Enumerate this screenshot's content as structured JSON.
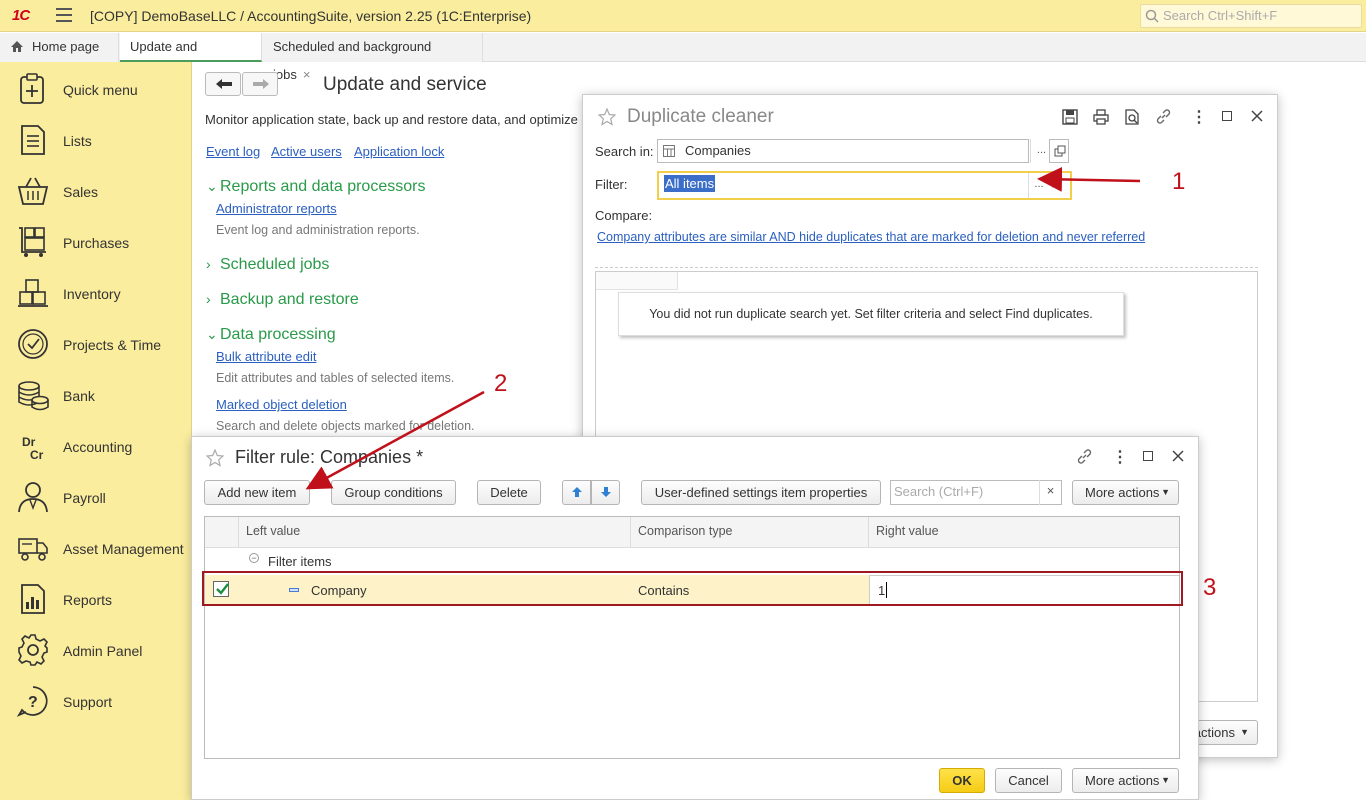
{
  "app": {
    "logo": "1C",
    "title": "[COPY] DemoBaseLLC / AccountingSuite, version 2.25  (1C:Enterprise)",
    "search_placeholder": "Search Ctrl+Shift+F"
  },
  "tabs": [
    {
      "label": "Home page"
    },
    {
      "label": "Update and service",
      "close": "×"
    },
    {
      "label": "Scheduled and background jobs",
      "close": "×"
    }
  ],
  "sidebar": {
    "items": [
      {
        "label": "Quick menu",
        "icon": "quick-menu-icon"
      },
      {
        "label": "Lists",
        "icon": "lists-icon"
      },
      {
        "label": "Sales",
        "icon": "basket-icon"
      },
      {
        "label": "Purchases",
        "icon": "cart-icon"
      },
      {
        "label": "Inventory",
        "icon": "boxes-icon"
      },
      {
        "label": "Projects & Time",
        "icon": "clock-icon"
      },
      {
        "label": "Bank",
        "icon": "coins-icon"
      },
      {
        "label": "Accounting",
        "icon": "dr-cr-icon"
      },
      {
        "label": "Payroll",
        "icon": "person-icon"
      },
      {
        "label": "Asset Management",
        "icon": "truck-icon"
      },
      {
        "label": "Reports",
        "icon": "report-icon"
      },
      {
        "label": "Admin Panel",
        "icon": "gear-icon"
      },
      {
        "label": "Support",
        "icon": "question-icon"
      }
    ]
  },
  "main": {
    "title": "Update and service",
    "description": "Monitor application state, back up and restore data, and optimize",
    "links": [
      "Event log",
      "Active users",
      "Application lock"
    ],
    "sections": {
      "reports": {
        "title": "Reports and data processors",
        "link": "Administrator reports",
        "desc": "Event log and administration reports."
      },
      "scheduled": {
        "title": "Scheduled jobs"
      },
      "backup": {
        "title": "Backup and restore"
      },
      "processing": {
        "title": "Data processing",
        "link1": "Bulk attribute edit",
        "desc1": "Edit attributes and tables of selected items.",
        "link2": "Marked object deletion",
        "desc2": "Search and delete objects marked for deletion."
      }
    }
  },
  "duplicate_cleaner": {
    "title": "Duplicate cleaner",
    "search_in_label": "Search in:",
    "search_in_value": "Companies",
    "filter_label": "Filter:",
    "filter_value": "All items",
    "compare_label": "Compare:",
    "compare_link": "Company attributes are similar AND hide duplicates that are marked for deletion and never referred",
    "message": "You did not run duplicate search yet. Set filter criteria and select Find duplicates.",
    "ellipsis": "...",
    "clear": "×",
    "more_actions_partial": "actions"
  },
  "filter_rule": {
    "title": "Filter rule: Companies *",
    "toolbar": {
      "add": "Add new item",
      "group": "Group conditions",
      "delete": "Delete",
      "props": "User-defined settings item properties",
      "search_placeholder": "Search (Ctrl+F)",
      "search_clear": "×",
      "more": "More actions"
    },
    "columns": [
      "Left value",
      "Comparison type",
      "Right value"
    ],
    "group_row": "Filter items",
    "row": {
      "left": "Company",
      "comparison": "Contains",
      "right": "1",
      "checked": true
    },
    "ok": "OK",
    "cancel": "Cancel",
    "more": "More actions"
  },
  "annotations": {
    "a1": "1",
    "a2": "2",
    "a3": "3",
    "color": "#c0111a"
  }
}
